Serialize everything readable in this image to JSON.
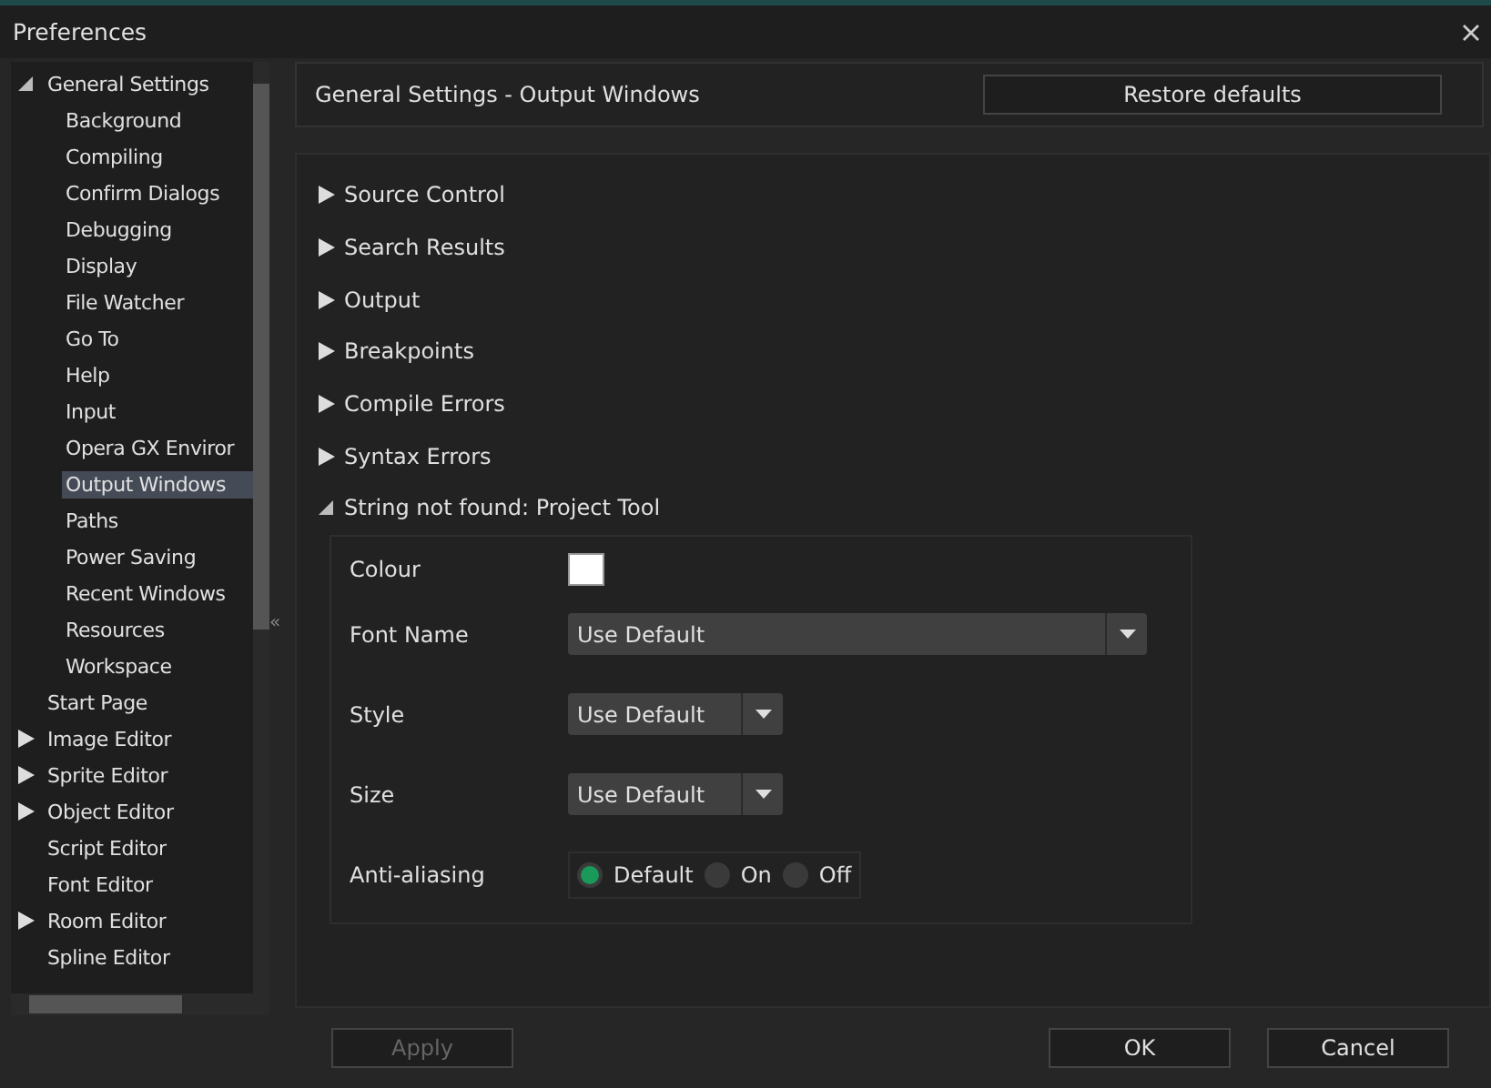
{
  "window": {
    "title": "Preferences"
  },
  "sidebar": {
    "items": [
      {
        "label": "General Settings",
        "expanded": true,
        "selected": false,
        "children": [
          {
            "label": "Background",
            "selected": false
          },
          {
            "label": "Compiling",
            "selected": false
          },
          {
            "label": "Confirm Dialogs",
            "selected": false
          },
          {
            "label": "Debugging",
            "selected": false
          },
          {
            "label": "Display",
            "selected": false
          },
          {
            "label": "File Watcher",
            "selected": false
          },
          {
            "label": "Go To",
            "selected": false
          },
          {
            "label": "Help",
            "selected": false
          },
          {
            "label": "Input",
            "selected": false
          },
          {
            "label": "Opera GX Enviror",
            "selected": false
          },
          {
            "label": "Output Windows",
            "selected": true
          },
          {
            "label": "Paths",
            "selected": false
          },
          {
            "label": "Power Saving",
            "selected": false
          },
          {
            "label": "Recent Windows",
            "selected": false
          },
          {
            "label": "Resources",
            "selected": false
          },
          {
            "label": "Workspace",
            "selected": false
          }
        ]
      },
      {
        "label": "Start Page",
        "selected": false
      },
      {
        "label": "Image Editor",
        "expanded": false,
        "selected": false
      },
      {
        "label": "Sprite Editor",
        "expanded": false,
        "selected": false
      },
      {
        "label": "Object Editor",
        "expanded": false,
        "selected": false
      },
      {
        "label": "Script Editor",
        "selected": false
      },
      {
        "label": "Font Editor",
        "selected": false
      },
      {
        "label": "Room Editor",
        "expanded": false,
        "selected": false
      },
      {
        "label": "Spline Editor",
        "selected": false
      }
    ]
  },
  "collapse_handle": "«",
  "header": {
    "title": "General Settings - Output Windows",
    "button": "Restore defaults"
  },
  "sections": [
    {
      "label": "Source Control",
      "expanded": false
    },
    {
      "label": "Search Results",
      "expanded": false
    },
    {
      "label": "Output",
      "expanded": false
    },
    {
      "label": "Breakpoints",
      "expanded": false
    },
    {
      "label": "Compile Errors",
      "expanded": false
    },
    {
      "label": "Syntax Errors",
      "expanded": false
    },
    {
      "label": "String not found: Project Tool",
      "expanded": true,
      "fields": [
        {
          "kind": "colour",
          "label": "Colour",
          "color": "#ffffff"
        },
        {
          "kind": "wide-dropdown",
          "label": "Font Name",
          "value": "Use Default"
        },
        {
          "kind": "dropdown",
          "label": "Style",
          "value": "Use Default"
        },
        {
          "kind": "dropdown",
          "label": "Size",
          "value": "Use Default"
        },
        {
          "kind": "radio",
          "label": "Anti-aliasing",
          "options": [
            {
              "label": "Default",
              "selected": true
            },
            {
              "label": "On",
              "selected": false
            },
            {
              "label": "Off",
              "selected": false
            }
          ]
        }
      ]
    }
  ],
  "buttons": [
    {
      "label": "Apply",
      "disabled": true
    },
    {
      "label": "OK",
      "disabled": false
    },
    {
      "label": "Cancel",
      "disabled": false
    }
  ]
}
